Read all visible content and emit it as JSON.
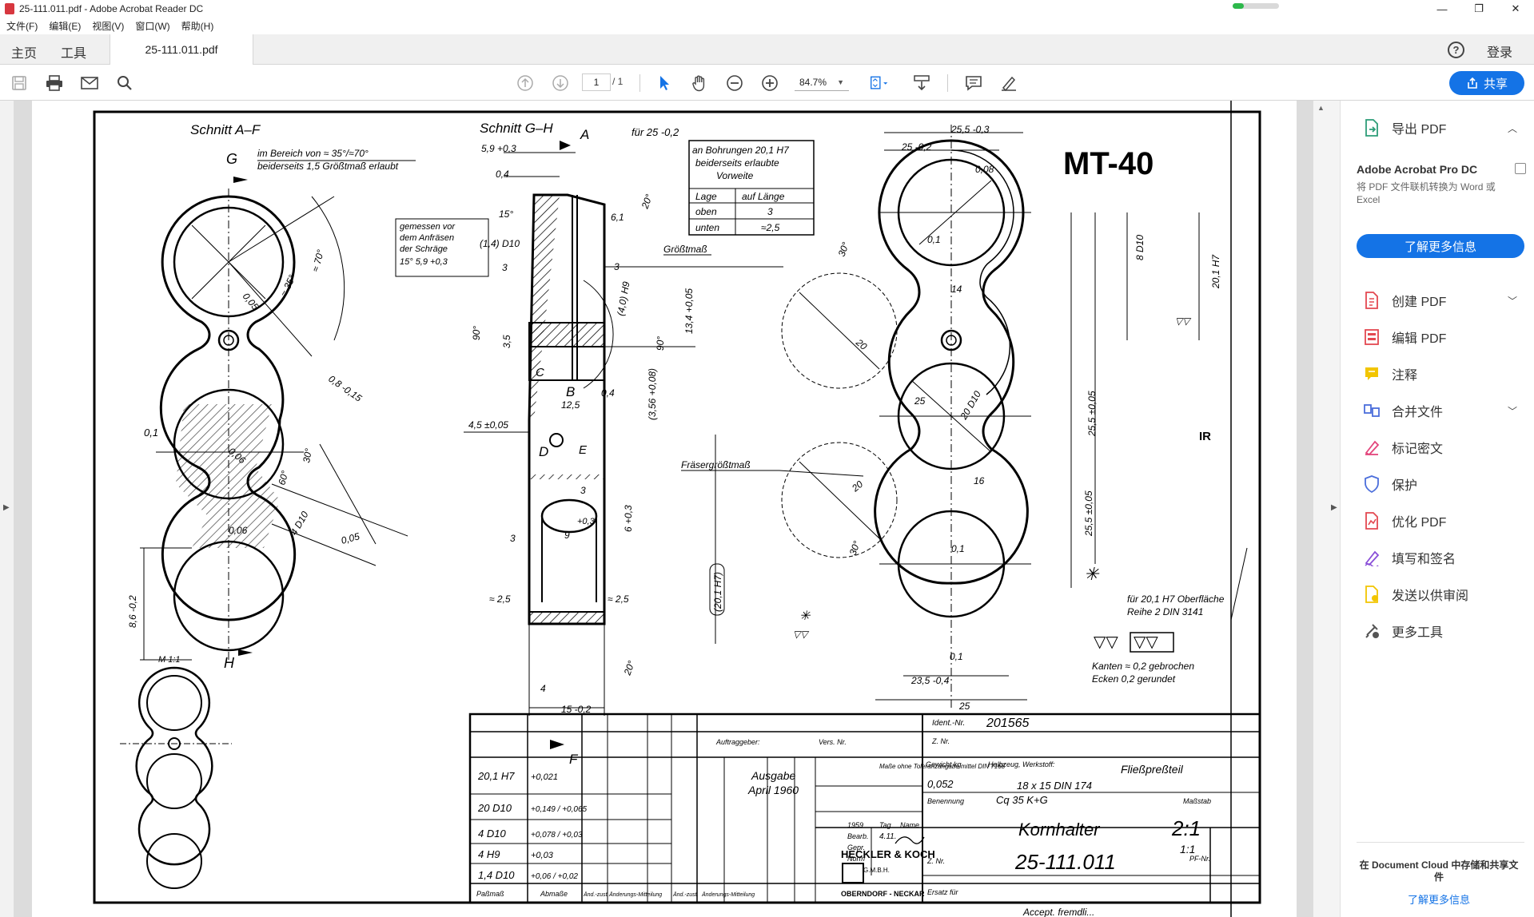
{
  "window": {
    "title": "25-111.011.pdf - Adobe Acrobat Reader DC",
    "minimize": "—",
    "restore": "❐",
    "close": "✕"
  },
  "menu": [
    "文件(F)",
    "编辑(E)",
    "视图(V)",
    "窗口(W)",
    "帮助(H)"
  ],
  "tabs": {
    "home": "主页",
    "tools": "工具",
    "document": "25-111.011.pdf",
    "help": "?",
    "login": "登录"
  },
  "toolbar": {
    "page_current": "1",
    "page_total": "/ 1",
    "zoom": "84.7%",
    "share": "共享"
  },
  "sidepanel": {
    "export_pdf": "导出 PDF",
    "promo_title": "Adobe Acrobat Pro DC",
    "promo_desc": "将 PDF 文件联机转换为 Word 或 Excel",
    "promo_button": "了解更多信息",
    "items": [
      {
        "label": "创建 PDF",
        "color": "#e34850",
        "chev": true
      },
      {
        "label": "编辑 PDF",
        "color": "#e34850",
        "chev": false
      },
      {
        "label": "注释",
        "color": "#f2c500",
        "chev": false
      },
      {
        "label": "合并文件",
        "color": "#4b6edb",
        "chev": true
      },
      {
        "label": "标记密文",
        "color": "#e3467c",
        "chev": false
      },
      {
        "label": "保护",
        "color": "#4b6edb",
        "chev": false
      },
      {
        "label": "优化 PDF",
        "color": "#e34850",
        "chev": false
      },
      {
        "label": "填写和签名",
        "color": "#8a4fd8",
        "chev": false
      },
      {
        "label": "发送以供审阅",
        "color": "#f2c500",
        "chev": false
      },
      {
        "label": "更多工具",
        "color": "#555555",
        "chev": false
      }
    ],
    "footer_title": "在 Document Cloud 中存储和共享文件",
    "footer_link": "了解更多信息"
  },
  "drawing": {
    "section_af": "Schnitt A–F",
    "section_gh": "Schnitt G–H",
    "part_code": "MT-40",
    "label_g": "G",
    "label_h": "H",
    "label_a": "A",
    "label_b": "B",
    "label_c": "C",
    "label_d": "D",
    "label_e": "E",
    "label_f": "F",
    "scale_note": "M 1:1",
    "note_range": "im Bereich von ≈ 35°/≈70°",
    "note_range2": "beiderseits 1,5 Größtmaß erlaubt",
    "note_measured": "gemessen vor",
    "note_measured2": "dem Anfräsen",
    "note_measured3": "der Schräge",
    "note_measured4": "15° 5,9 +0,3",
    "note_bore": "an Bohrungen 20,1 H7",
    "note_bore2": "beiderseits erlaubte",
    "note_bore3": "Vorweite",
    "bore_table_h1": "Lage",
    "bore_table_h2": "auf Länge",
    "bore_r1c1": "oben",
    "bore_r1c2": "3",
    "bore_r2c1": "unten",
    "bore_r2c2": "≈2,5",
    "for_25": "für 25 -0,2",
    "groesstmass": "Größtmaß",
    "fraeser": "Fräsergrößtmaß",
    "surface_note": "für 20,1 H7 Oberfläche",
    "surface_note2": "Reihe 2 DIN 3141",
    "edge_note": "Kanten ≈ 0,2 gebrochen",
    "edge_note2": "Ecken 0,2 gerundet",
    "ident_label": "Ident.-Nr.",
    "ident_no": "201565",
    "auftraggeber": "Auftraggeber:",
    "vers": "Vers. Nr.",
    "znr": "Z. Nr.",
    "ausgabe": "Ausgabe",
    "ausgabe_date": "April 1960",
    "masse": "Maße ohne Toleranzangabe mittel DIN 7168",
    "gewicht": "Gewicht kg",
    "gewicht_val": "0,052",
    "halbzeug": "Halbzeug, Werkstoff:",
    "fliess": "Fließpreßteil",
    "material1": "18 x 15 DIN 174",
    "material2": "Cq 35 K+G",
    "benennung": "Benennung",
    "name": "Kornhalter",
    "massstab": "Maßstab",
    "scale": "2:1",
    "scale2": "1:1",
    "drawing_no": "25-111.011",
    "company": "HECKLER & KOCH",
    "company_sub": "G.M.B.H.",
    "company_city": "OBERNDORF - NECKAR",
    "year": "1959",
    "bearb": "Bearb.",
    "gepr": "Gepr.",
    "norm": "Norm",
    "tag": "Tag",
    "name_col": "Name",
    "bearb_date": "4.11.",
    "ersatz": "Ersatz für",
    "pf": "PF-Nr.",
    "tol_rows": [
      {
        "nom": "20,1 H7",
        "dev": "+0,021"
      },
      {
        "nom": "20 D10",
        "dev": "+0,149 / +0,065"
      },
      {
        "nom": "4 D10",
        "dev": "+0,078 / +0,03"
      },
      {
        "nom": "4 H9",
        "dev": "+0,03"
      },
      {
        "nom": "1,4 D10",
        "dev": "+0,06 / +0,02"
      }
    ],
    "pass": "Paßmaß",
    "abmasse": "Abmaße",
    "aend": "Änd.-zust.",
    "aend_mitt": "Änderungs-Mitteilung",
    "accept": "Accept. fremdli..."
  }
}
